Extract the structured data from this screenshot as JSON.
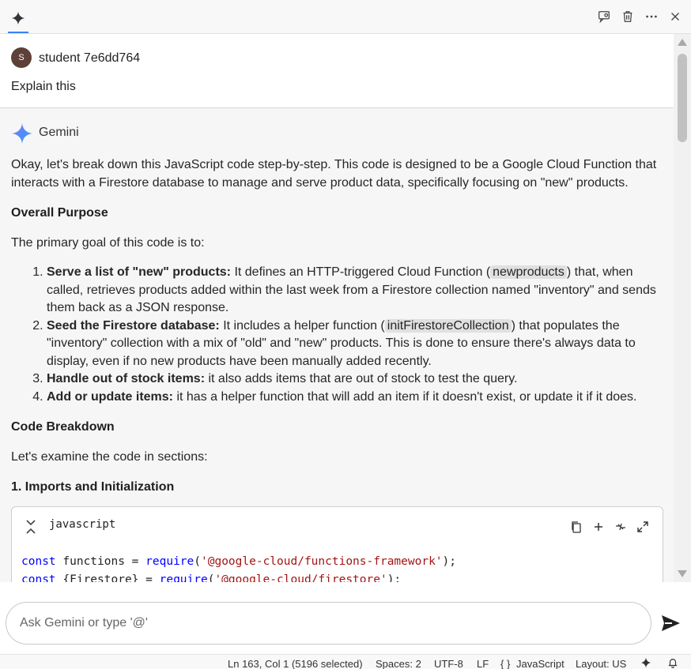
{
  "user": {
    "avatar_letter": "S",
    "name": "student 7e6dd764",
    "message": "Explain this"
  },
  "assistant": {
    "name": "Gemini",
    "intro": "Okay, let's break down this JavaScript code step-by-step. This code is designed to be a Google Cloud Function that interacts with a Firestore database to manage and serve product data, specifically focusing on \"new\" products.",
    "overall_heading": "Overall Purpose",
    "primary_goal": "The primary goal of this code is to:",
    "items": [
      {
        "bold": "Serve a list of \"new\" products:",
        "pre": " It defines an HTTP-triggered Cloud Function (",
        "code": "newproducts",
        "post": ") that, when called, retrieves products added within the last week from a Firestore collection named \"inventory\" and sends them back as a JSON response."
      },
      {
        "bold": "Seed the Firestore database:",
        "pre": " It includes a helper function (",
        "code": "initFirestoreCollection",
        "post": ") that populates the \"inventory\" collection with a mix of \"old\" and \"new\" products. This is done to ensure there's always data to display, even if no new products have been manually added recently."
      },
      {
        "bold": "Handle out of stock items:",
        "pre": " it also adds items that are out of stock to test the query.",
        "code": "",
        "post": ""
      },
      {
        "bold": "Add or update items:",
        "pre": " it has a helper function that will add an item if it doesn't exist, or update it if it does.",
        "code": "",
        "post": ""
      }
    ],
    "breakdown_heading": "Code Breakdown",
    "examine": "Let's examine the code in sections:",
    "section1_heading": "1. Imports and Initialization"
  },
  "codeblock": {
    "language": "javascript",
    "line1": {
      "kw": "const",
      "ident": " functions = ",
      "fn": "require",
      "open": "(",
      "str": "'@google-cloud/functions-framework'",
      "close": ");"
    },
    "line2": {
      "kw": "const",
      "ident": " {Firestore} = ",
      "fn": "require",
      "open": "(",
      "str": "'@google-cloud/firestore'",
      "close": ");"
    }
  },
  "input": {
    "placeholder": "Ask Gemini or type '@'"
  },
  "statusbar": {
    "position": "Ln 163, Col 1 (5196 selected)",
    "spaces": "Spaces: 2",
    "encoding": "UTF-8",
    "eol": "LF",
    "language": "JavaScript",
    "layout": "Layout: US"
  },
  "icons": {
    "spark": "gemini-spark-icon",
    "chat_view": "chat-view-icon",
    "trash": "trash-icon",
    "more": "more-icon",
    "close": "close-icon",
    "copy": "copy-icon",
    "insert": "insert-icon",
    "diff": "diff-icon",
    "expand": "expand-icon",
    "send": "send-icon",
    "bell": "bell-icon"
  },
  "colors": {
    "accent": "#3b82f6",
    "avatar": "#5d4037",
    "keyword": "#0000ff",
    "string": "#a31515"
  }
}
